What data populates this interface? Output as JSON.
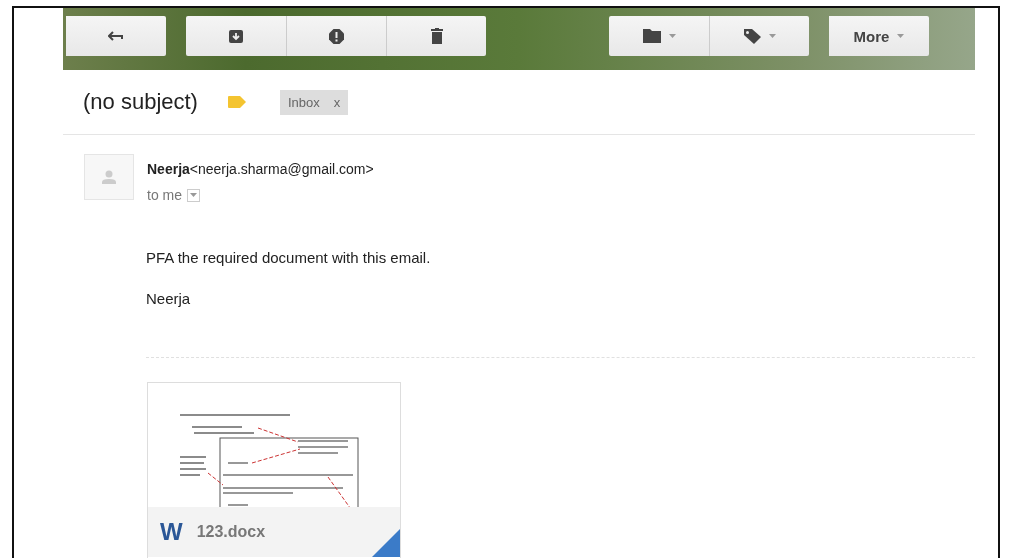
{
  "toolbar": {
    "groups": [
      {
        "buttons": [
          {
            "kind": "reply",
            "dropdown": false
          }
        ]
      },
      {
        "buttons": [
          {
            "kind": "archive",
            "dropdown": false
          },
          {
            "kind": "spam",
            "dropdown": false
          },
          {
            "kind": "delete",
            "dropdown": false
          }
        ]
      },
      {
        "buttons": [
          {
            "kind": "folder",
            "dropdown": true
          },
          {
            "kind": "tag",
            "dropdown": true
          }
        ]
      },
      {
        "buttons": [
          {
            "kind": "text",
            "label": "More",
            "dropdown": true
          }
        ]
      }
    ]
  },
  "message": {
    "subject": "(no subject)",
    "important": true,
    "labels": [
      {
        "text": "Inbox",
        "remove": "x"
      }
    ],
    "sender": "**Neerja**<neerja.sharma@gmail.com>",
    "recipient": "to me",
    "body": [
      "PFA the required document with this email.",
      "Neerja"
    ],
    "attachments": [
      {
        "type_letter": "W",
        "name": "123.docx"
      }
    ]
  }
}
